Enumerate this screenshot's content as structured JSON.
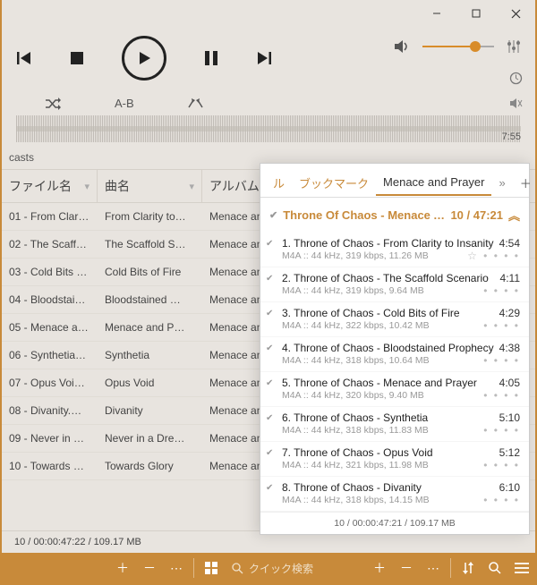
{
  "window": {
    "time_right": "7:55"
  },
  "subcontrols": {
    "ab": "A-B"
  },
  "library": {
    "top_label": "casts",
    "cols": {
      "file": "ファイル名",
      "song": "曲名",
      "album": "アルバム"
    },
    "rows": [
      {
        "file": "01 - From Clari…",
        "song": "From Clarity to…",
        "album": "Menace an…"
      },
      {
        "file": "02 - The Scaff…",
        "song": "The Scaffold S…",
        "album": "Menace an…"
      },
      {
        "file": "03 - Cold Bits …",
        "song": "Cold Bits of Fire",
        "album": "Menace an…"
      },
      {
        "file": "04 - Bloodstai…",
        "song": "Bloodstained …",
        "album": "Menace an…"
      },
      {
        "file": "05 - Menace a…",
        "song": "Menace and P…",
        "album": "Menace an…"
      },
      {
        "file": "06 - Synthetia…",
        "song": "Synthetia",
        "album": "Menace an…"
      },
      {
        "file": "07 - Opus Voi…",
        "song": "Opus Void",
        "album": "Menace an…"
      },
      {
        "file": "08 - Divanity.m…",
        "song": "Divanity",
        "album": "Menace an…"
      },
      {
        "file": "09 - Never in a…",
        "song": "Never in a Dre…",
        "album": "Menace an…"
      },
      {
        "file": "10 - Towards …",
        "song": "Towards Glory",
        "album": "Menace an…"
      }
    ],
    "status": "10 / 00:00:47:22 / 109.17 MB"
  },
  "panel": {
    "tabs": {
      "ru": "ル",
      "bookmark": "ブックマーク",
      "active": "Menace and Prayer"
    },
    "header": {
      "title": "Throne Of Chaos - Menace A…",
      "right": "10 / 47:21"
    },
    "tracks": [
      {
        "n": "1.",
        "t": "Throne of Chaos - From Clarity to Insanity",
        "d": "4:54",
        "m": "M4A :: 44 kHz, 319 kbps, 11.26 MB",
        "star": true
      },
      {
        "n": "2.",
        "t": "Throne of Chaos - The Scaffold Scenario",
        "d": "4:11",
        "m": "M4A :: 44 kHz, 319 kbps, 9.64 MB"
      },
      {
        "n": "3.",
        "t": "Throne of Chaos - Cold Bits of Fire",
        "d": "4:29",
        "m": "M4A :: 44 kHz, 322 kbps, 10.42 MB"
      },
      {
        "n": "4.",
        "t": "Throne of Chaos - Bloodstained Prophecy",
        "d": "4:38",
        "m": "M4A :: 44 kHz, 318 kbps, 10.64 MB"
      },
      {
        "n": "5.",
        "t": "Throne of Chaos - Menace and Prayer",
        "d": "4:05",
        "m": "M4A :: 44 kHz, 320 kbps, 9.40 MB"
      },
      {
        "n": "6.",
        "t": "Throne of Chaos - Synthetia",
        "d": "5:10",
        "m": "M4A :: 44 kHz, 318 kbps, 11.83 MB"
      },
      {
        "n": "7.",
        "t": "Throne of Chaos - Opus Void",
        "d": "5:12",
        "m": "M4A :: 44 kHz, 321 kbps, 11.98 MB"
      },
      {
        "n": "8.",
        "t": "Throne of Chaos - Divanity",
        "d": "6:10",
        "m": "M4A :: 44 kHz, 318 kbps, 14.15 MB"
      }
    ],
    "status": "10 / 00:00:47:21 / 109.17 MB"
  },
  "bottombar": {
    "search_placeholder": "クイック検索"
  },
  "volume": {
    "percent": 70
  }
}
